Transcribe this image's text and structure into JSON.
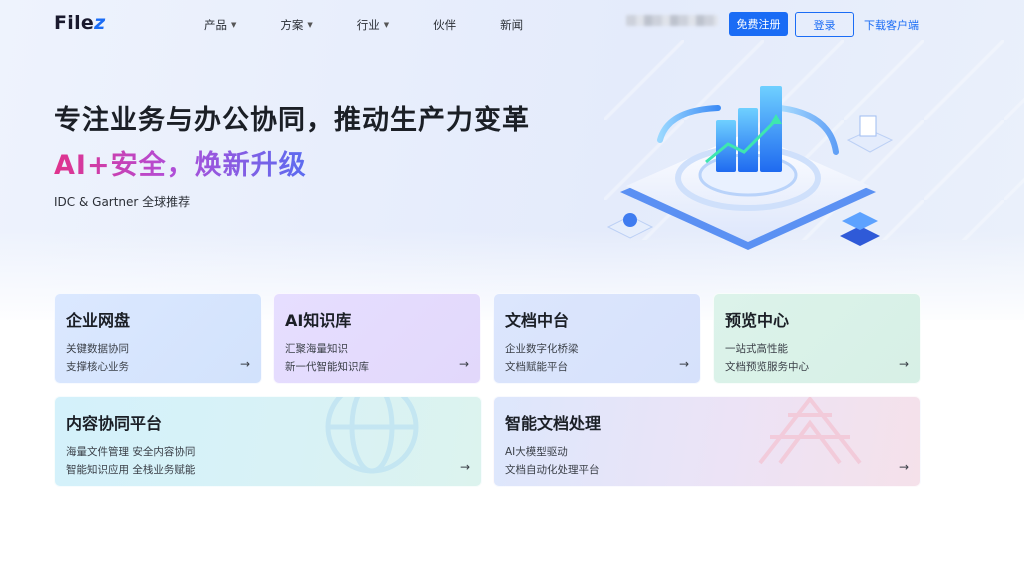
{
  "header": {
    "logo": {
      "text": "File",
      "accent": "z"
    },
    "nav": [
      {
        "label": "产品",
        "has_dropdown": true
      },
      {
        "label": "方案",
        "has_dropdown": true
      },
      {
        "label": "行业",
        "has_dropdown": true
      },
      {
        "label": "伙伴",
        "has_dropdown": false
      },
      {
        "label": "新闻",
        "has_dropdown": false
      }
    ],
    "register_label": "免费注册",
    "login_label": "登录",
    "download_label": "下载客户端"
  },
  "hero": {
    "title": "专注业务与办公协同，推动生产力变革",
    "subtitle": "AI+安全，焕新升级",
    "note": "IDC & Gartner 全球推荐"
  },
  "cards": [
    {
      "title": "企业网盘",
      "lines": [
        "关键数据协同",
        "支撑核心业务"
      ]
    },
    {
      "title": "AI知识库",
      "lines": [
        "汇聚海量知识",
        "新一代智能知识库"
      ]
    },
    {
      "title": "文档中台",
      "lines": [
        "企业数字化桥梁",
        "文档赋能平台"
      ]
    },
    {
      "title": "预览中心",
      "lines": [
        "一站式高性能",
        "文档预览服务中心"
      ]
    },
    {
      "title": "内容协同平台",
      "lines": [
        "海量文件管理 安全内容协同",
        "智能知识应用 全栈业务赋能"
      ]
    },
    {
      "title": "智能文档处理",
      "lines": [
        "AI大模型驱动",
        "文档自动化处理平台"
      ]
    }
  ],
  "arrow": "→",
  "colors": {
    "brand": "#1a6cf5",
    "gradient_start": "#e0338c",
    "gradient_end": "#5b6cf0"
  }
}
